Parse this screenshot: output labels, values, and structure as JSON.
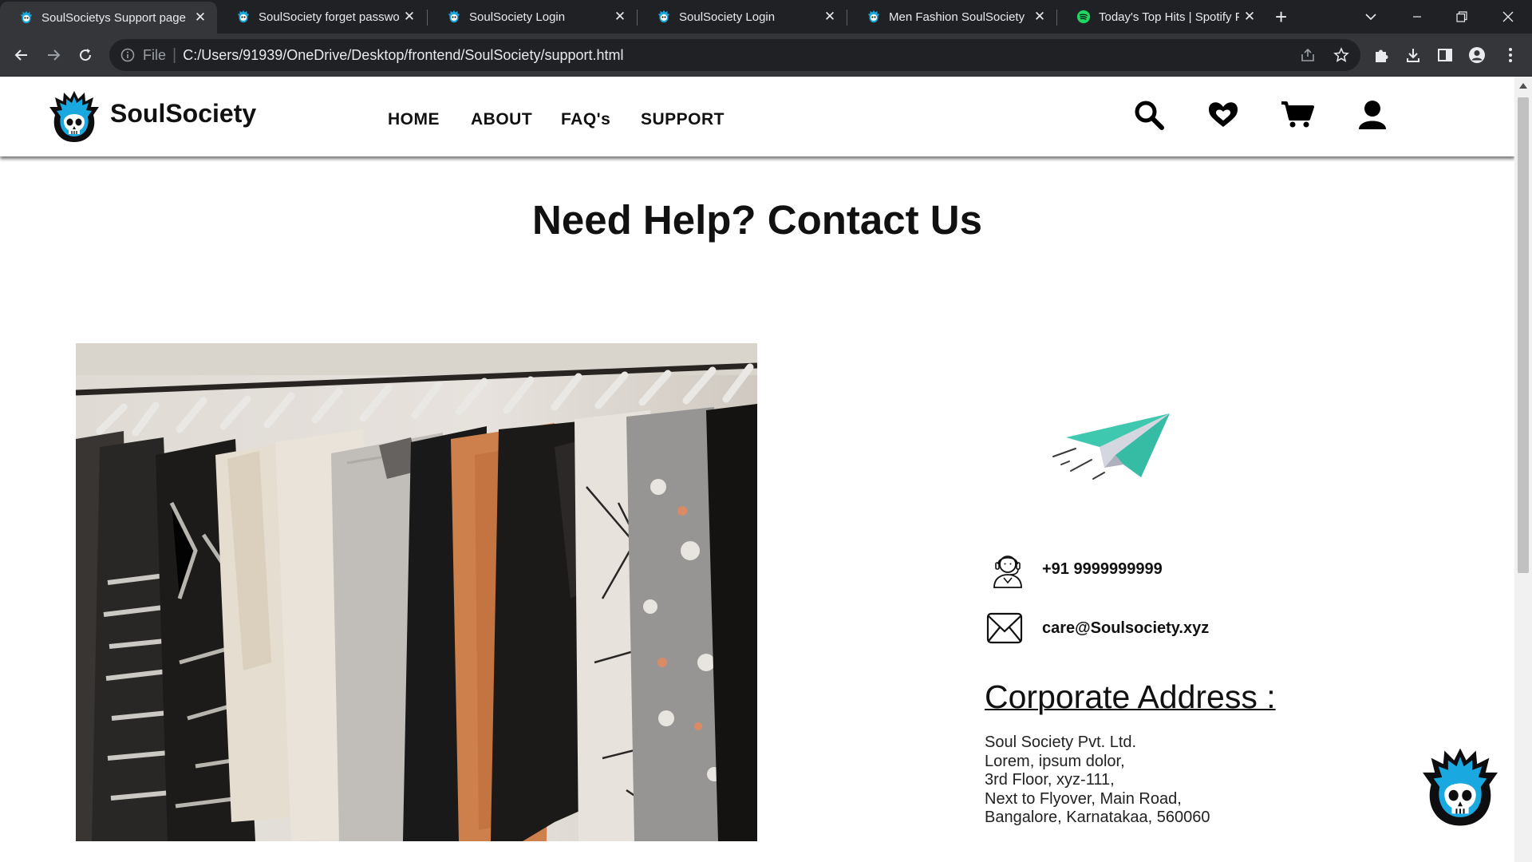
{
  "browser": {
    "tabs": [
      {
        "title": "SoulSocietys Support page",
        "active": true,
        "icon": "soulsociety-favicon"
      },
      {
        "title": "SoulSociety forget password",
        "active": false,
        "icon": "soulsociety-favicon"
      },
      {
        "title": "SoulSociety Login",
        "active": false,
        "icon": "soulsociety-favicon"
      },
      {
        "title": "SoulSociety Login",
        "active": false,
        "icon": "soulsociety-favicon"
      },
      {
        "title": "Men Fashion SoulSociety",
        "active": false,
        "icon": "soulsociety-favicon"
      },
      {
        "title": "Today's Top Hits | Spotify Playlist",
        "active": false,
        "icon": "spotify-favicon"
      }
    ],
    "close_glyph": "✕",
    "new_tab_glyph": "+",
    "address": {
      "scheme_label": "File",
      "url": "C:/Users/91939/OneDrive/Desktop/frontend/SoulSociety/support.html"
    }
  },
  "header": {
    "brand": "SoulSociety",
    "nav": [
      "HOME",
      "ABOUT",
      "FAQ's",
      "SUPPORT"
    ],
    "icons": [
      "search-icon",
      "heart-icon",
      "cart-icon",
      "user-icon"
    ]
  },
  "main": {
    "title": "Need Help? Contact Us",
    "phone": "+91 9999999999",
    "email": "care@Soulsociety.xyz",
    "address_heading": "Corporate Address :",
    "address_lines": [
      "Soul Society Pvt. Ltd.",
      "Lorem, ipsum dolor,",
      "3rd Floor, xyz-111,",
      "Next to Flyover, Main Road,",
      "Bangalore, Karnatakaa, 560060"
    ]
  },
  "colors": {
    "browser_dark": "#202124",
    "browser_toolbar": "#35363a",
    "plane_teal": "#3ec8b0",
    "logo_blue": "#1aa8e0",
    "spotify_green": "#1ed760"
  }
}
